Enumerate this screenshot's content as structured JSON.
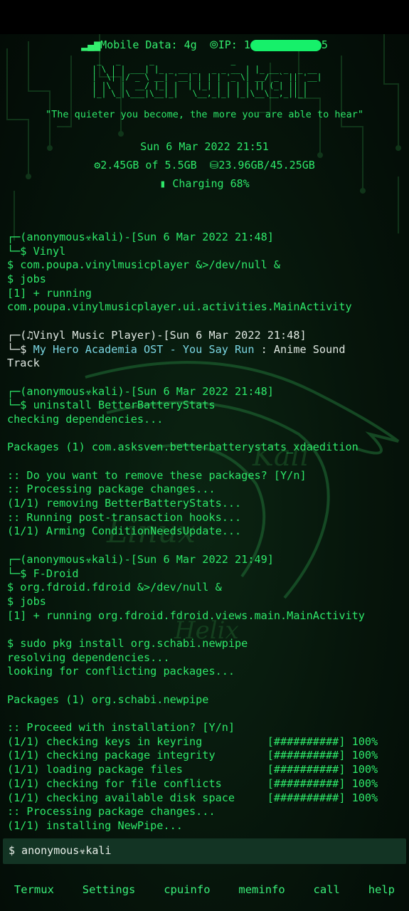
{
  "status": {
    "mobile_data": "Mobile Data: 4g",
    "ip_label": "IP: 1",
    "ip_tail": "5"
  },
  "banner_art": [
    "  _   _      _                _                 ",
    " | \\ | | ___| |_ _ __ _   _ _ __ | |_ __ _  _ __ ",
    " |  \\| |/ _ \\ __| '__| | | | '_ \\| __/ _` || '__|",
    " | |\\  |  __/ |_| |  | |_| | | | | || (_| || |   ",
    " |_| \\_|\\___|\\__|_|   \\__,_|_| |_|\\__\\__,_||_|   "
  ],
  "quote": "\"The quieter you become, the more you are able to hear\"",
  "datetime": "Sun 6 Mar 2022 21:51",
  "ram": "2.45GB of 5.5GB",
  "disk": "23.96GB/45.25GB",
  "charging": "Charging 68%",
  "terminal": {
    "lines": [
      {
        "t": "┌─(anonymous☣kali)-[Sun 6 Mar 2022 21:48]"
      },
      {
        "t": "└─$ Vinyl"
      },
      {
        "t": "$ com.poupa.vinylmusicplayer &>/dev/null &"
      },
      {
        "t": "$ jobs"
      },
      {
        "t": "[1] + running"
      },
      {
        "t": "com.poupa.vinylmusicplayer.ui.activities.MainActivity"
      },
      {
        "t": ""
      },
      {
        "t": "┌─(♫Vinyl Music Player)-[Sun 6 Mar 2022 21:48]",
        "cls": "w"
      },
      {
        "t": "└─$ ",
        "cls": "w",
        "song": "My Hero Academia OST - You Say Run",
        "rest": " : Anime Sound"
      },
      {
        "t": "Track",
        "cls": "w"
      },
      {
        "t": ""
      },
      {
        "t": "┌─(anonymous☣kali)-[Sun 6 Mar 2022 21:48]"
      },
      {
        "t": "└─$ uninstall BetterBatteryStats"
      },
      {
        "t": "checking dependencies..."
      },
      {
        "t": ""
      },
      {
        "t": "Packages (1) com.asksven.betterbatterystats_xdaedition"
      },
      {
        "t": ""
      },
      {
        "t": ":: Do you want to remove these packages? [Y/n]"
      },
      {
        "t": ":: Processing package changes..."
      },
      {
        "t": "(1/1) removing BetterBatteryStats..."
      },
      {
        "t": ":: Running post-transaction hooks..."
      },
      {
        "t": "(1/1) Arming ConditionNeedsUpdate..."
      },
      {
        "t": ""
      },
      {
        "t": "┌─(anonymous☣kali)-[Sun 6 Mar 2022 21:49]"
      },
      {
        "t": "└─$ F-Droid"
      },
      {
        "t": "$ org.fdroid.fdroid &>/dev/null &"
      },
      {
        "t": "$ jobs"
      },
      {
        "t": "[1] + running org.fdroid.fdroid.views.main.MainActivity"
      },
      {
        "t": ""
      },
      {
        "t": "$ sudo pkg install org.schabi.newpipe"
      },
      {
        "t": "resolving dependencies..."
      },
      {
        "t": "looking for conflicting packages..."
      },
      {
        "t": ""
      },
      {
        "t": "Packages (1) org.schabi.newpipe"
      },
      {
        "t": ""
      },
      {
        "t": ":: Proceed with installation? [Y/n]"
      },
      {
        "t": "(1/1) checking keys in keyring          [##########] 100%"
      },
      {
        "t": "(1/1) checking package integrity        [##########] 100%"
      },
      {
        "t": "(1/1) loading package files             [##########] 100%"
      },
      {
        "t": "(1/1) checking for file conflicts       [##########] 100%"
      },
      {
        "t": "(1/1) checking available disk space     [##########] 100%"
      },
      {
        "t": ":: Processing package changes..."
      },
      {
        "t": "(1/1) installing NewPipe..."
      }
    ]
  },
  "watermarks": {
    "kali": "Kali",
    "linux": "Linux",
    "helix": "Helix"
  },
  "prompt": "$ anonymous☣kali",
  "extra_keys": [
    "Termux",
    "Settings",
    "cpuinfo",
    "meminfo",
    "call",
    "help"
  ]
}
